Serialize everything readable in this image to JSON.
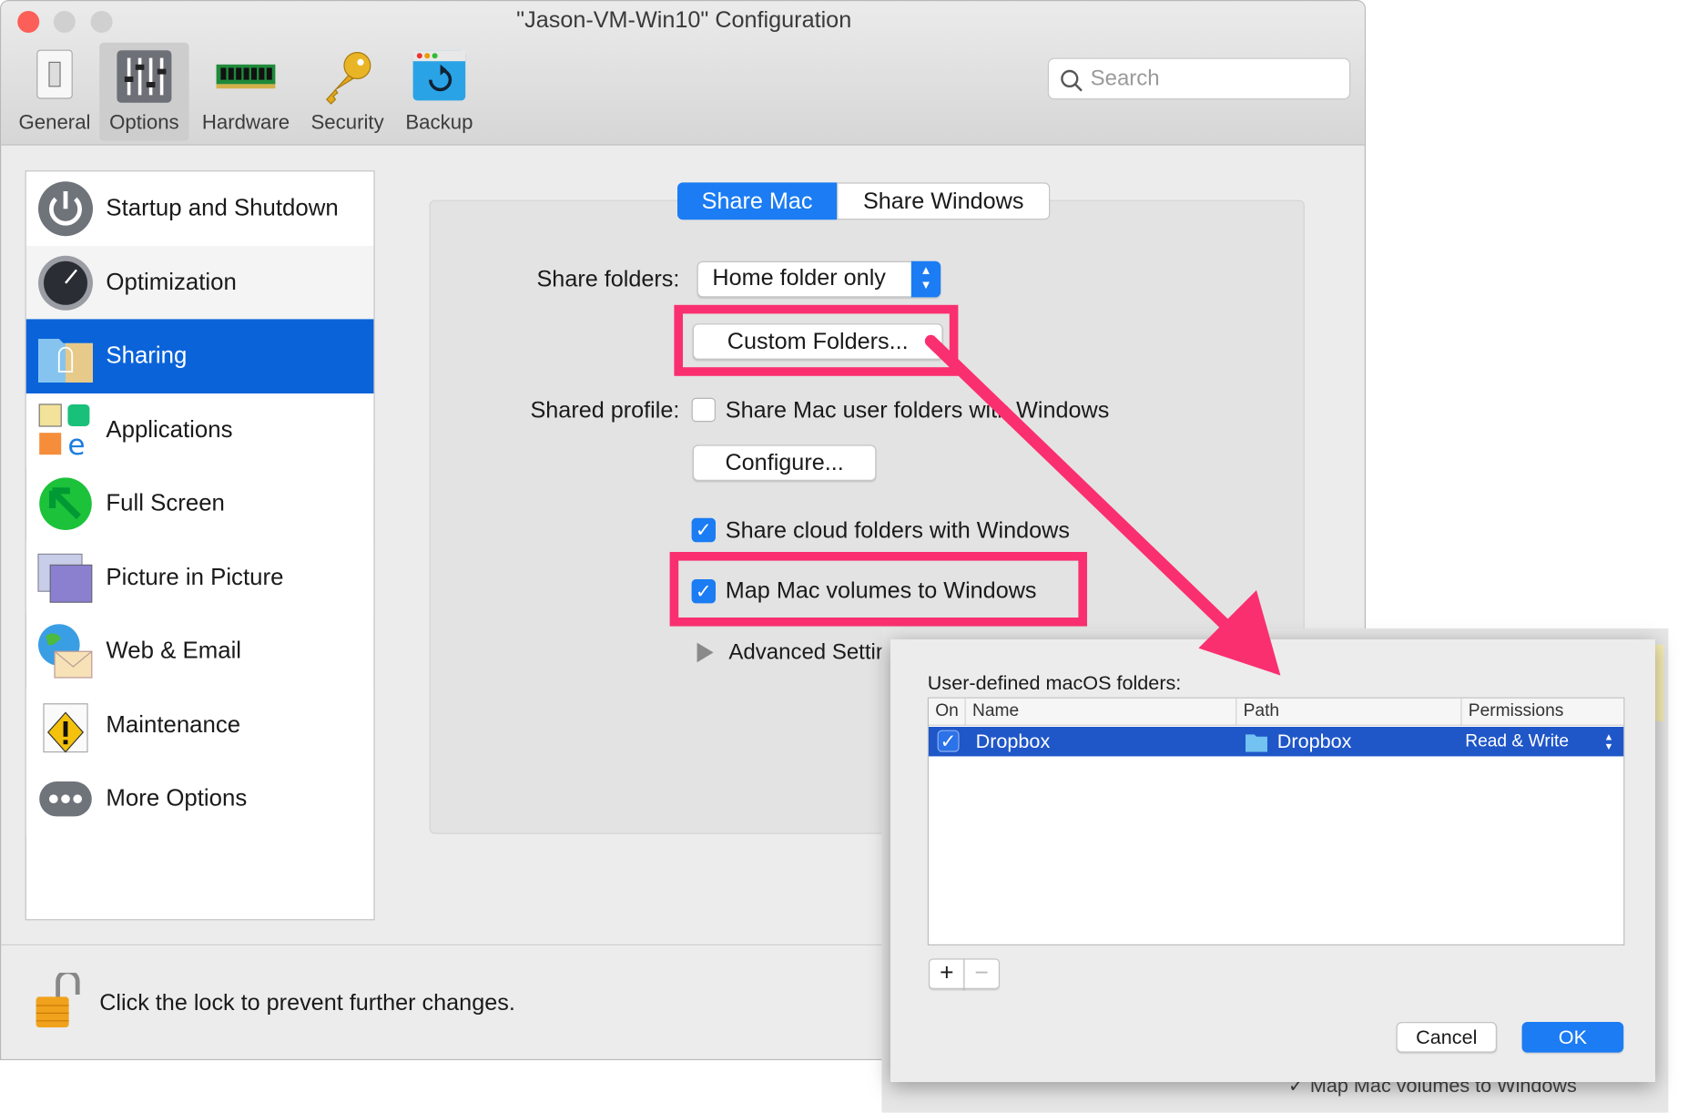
{
  "window": {
    "title": "\"Jason-VM-Win10\" Configuration"
  },
  "toolbar": {
    "items": [
      {
        "label": "General",
        "icon": "switch-icon"
      },
      {
        "label": "Options",
        "icon": "sliders-icon",
        "selected": true
      },
      {
        "label": "Hardware",
        "icon": "ram-chip-icon"
      },
      {
        "label": "Security",
        "icon": "key-icon"
      },
      {
        "label": "Backup",
        "icon": "backup-icon"
      }
    ],
    "search_placeholder": "Search"
  },
  "sidebar": {
    "items": [
      {
        "label": "Startup and Shutdown",
        "icon": "power-icon"
      },
      {
        "label": "Optimization",
        "icon": "speedometer-icon"
      },
      {
        "label": "Sharing",
        "icon": "shared-folder-icon",
        "selected": true
      },
      {
        "label": "Applications",
        "icon": "applications-icon"
      },
      {
        "label": "Full Screen",
        "icon": "full-screen-icon"
      },
      {
        "label": "Picture in Picture",
        "icon": "picture-in-picture-icon"
      },
      {
        "label": "Web & Email",
        "icon": "globe-mail-icon"
      },
      {
        "label": "Maintenance",
        "icon": "maintenance-icon"
      },
      {
        "label": "More Options",
        "icon": "more-icon"
      }
    ]
  },
  "main": {
    "tabs": [
      {
        "label": "Share Mac",
        "selected": true
      },
      {
        "label": "Share Windows"
      }
    ],
    "share_folders_label": "Share folders:",
    "share_folders_value": "Home folder only",
    "custom_folders_button": "Custom Folders...",
    "shared_profile_label": "Shared profile:",
    "share_user_folders": {
      "label": "Share Mac user folders with Windows",
      "checked": false
    },
    "configure_button": "Configure...",
    "share_cloud": {
      "label": "Share cloud folders with Windows",
      "checked": true
    },
    "map_volumes": {
      "label": "Map Mac volumes to Windows",
      "checked": true
    },
    "advanced": "Advanced Settin"
  },
  "footer": {
    "lock_text": "Click the lock to prevent further changes."
  },
  "dialog": {
    "title": "User-defined macOS folders:",
    "columns": [
      "On",
      "Name",
      "Path",
      "Permissions"
    ],
    "rows": [
      {
        "on": true,
        "name": "Dropbox",
        "path": "Dropbox",
        "permissions": "Read & Write"
      }
    ],
    "add": "+",
    "remove": "−",
    "cancel": "Cancel",
    "ok": "OK"
  },
  "background_window": {
    "map_volumes": "Map Mac volumes to Windows"
  },
  "colors": {
    "accent": "#0a63d9",
    "highlight": "#fa2f70",
    "selection": "#1f56c8"
  }
}
